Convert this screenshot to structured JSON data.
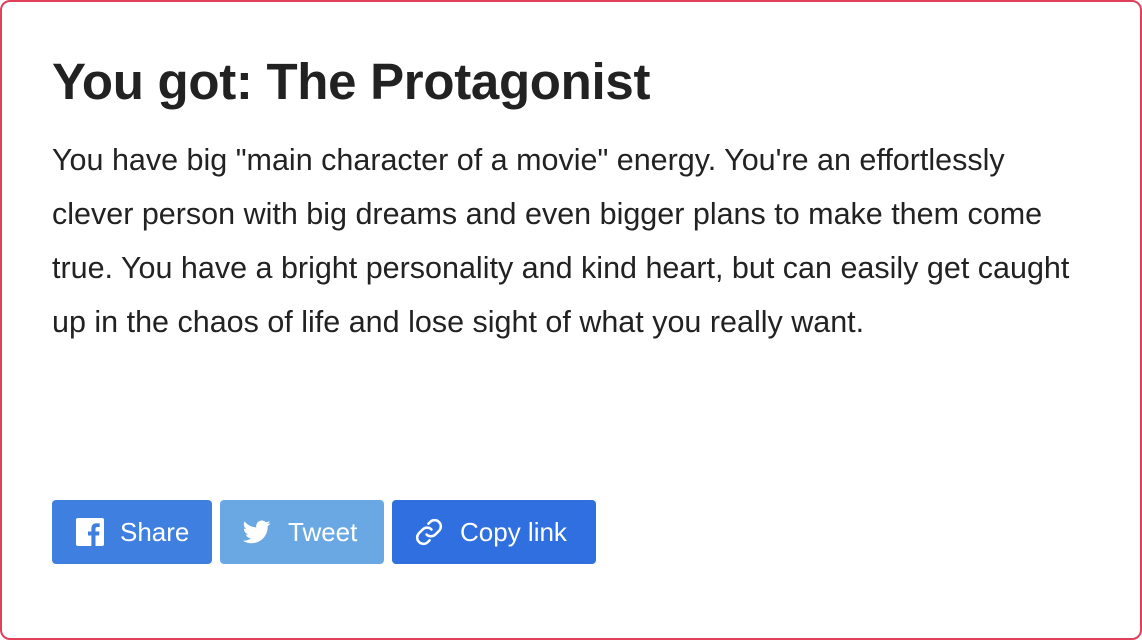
{
  "result": {
    "title": "You got: The Protagonist",
    "description": "You have big \"main character of a movie\" energy. You're an effortlessly clever person with big dreams and even bigger plans to make them come true. You have a bright personality and kind heart, but can easily get caught up in the chaos of life and lose sight of what you really want."
  },
  "share": {
    "facebook_label": "Share",
    "twitter_label": "Tweet",
    "copy_label": "Copy link",
    "facebook_icon": "facebook-icon",
    "twitter_icon": "twitter-bird-icon",
    "copy_icon": "link-icon"
  },
  "colors": {
    "border": "#e0405a",
    "text": "#222222",
    "facebook_button": "#3f7fe0",
    "twitter_button": "#6aa8e4",
    "copy_button": "#2f6fe0"
  }
}
